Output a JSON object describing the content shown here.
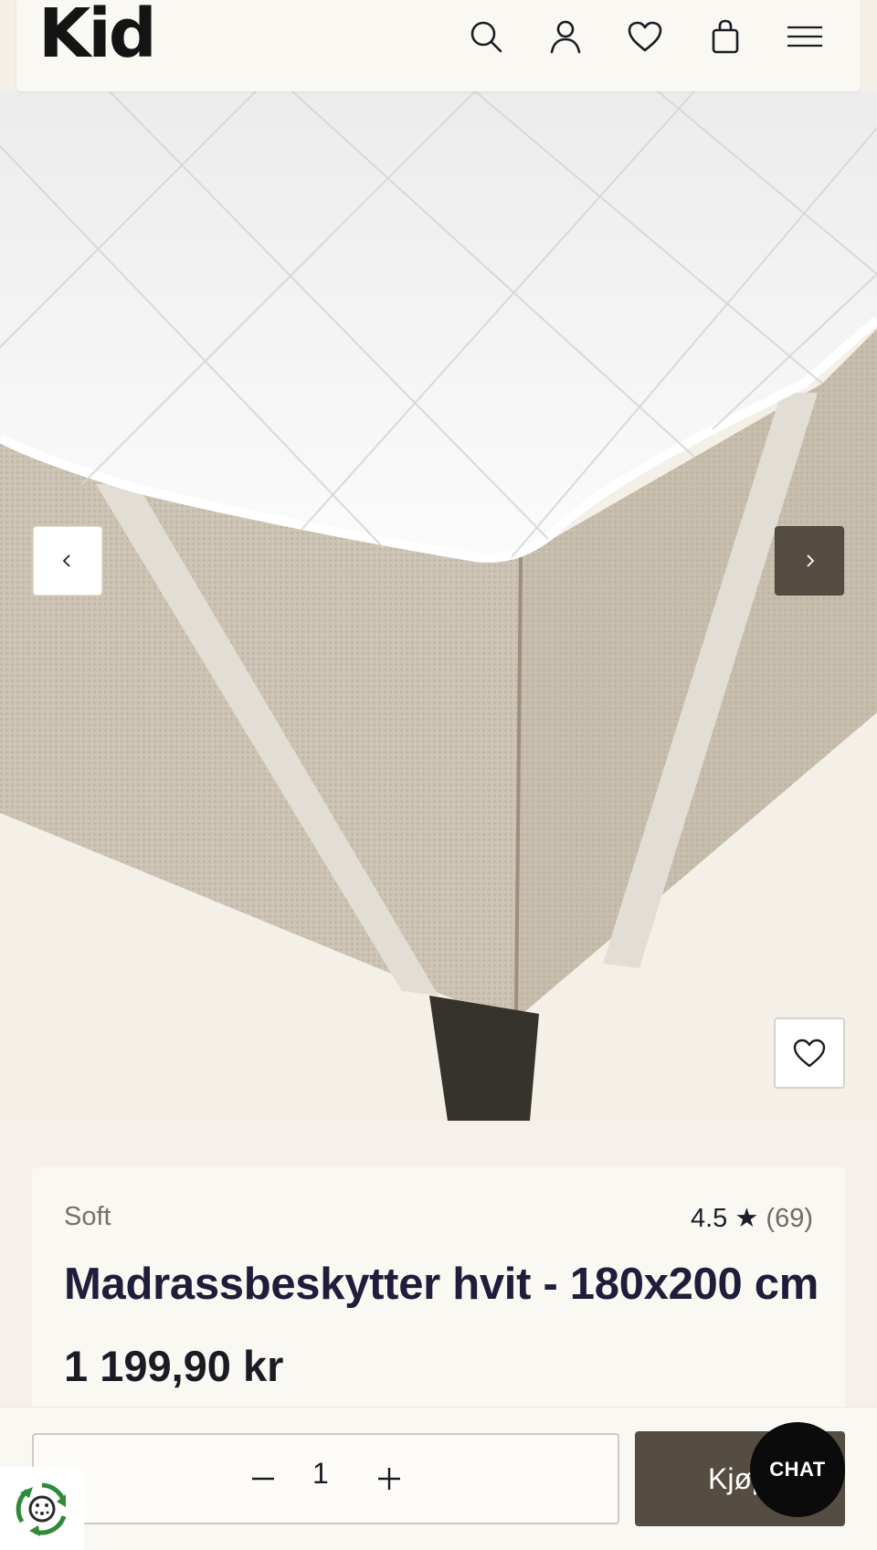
{
  "header": {
    "logo": "Kid",
    "icons": [
      "search-icon",
      "account-icon",
      "wishlist-icon",
      "cart-icon",
      "menu-icon"
    ]
  },
  "gallery": {
    "prev_icon": "chevron-left-icon",
    "next_icon": "chevron-right-icon",
    "favorite_icon": "heart-icon"
  },
  "product": {
    "brand": "Soft",
    "rating_value": "4.5",
    "rating_star": "★",
    "rating_count": "(69)",
    "title": "Madrassbeskytter hvit - 180x200 cm",
    "price": "1 199,90 kr"
  },
  "purchase": {
    "quantity": "1",
    "buy_label": "Kjøp",
    "chat_label": "CHAT"
  },
  "colors": {
    "accent": "#554d42",
    "page_background": "#f5f1ea",
    "card_background": "#faf8f3"
  }
}
